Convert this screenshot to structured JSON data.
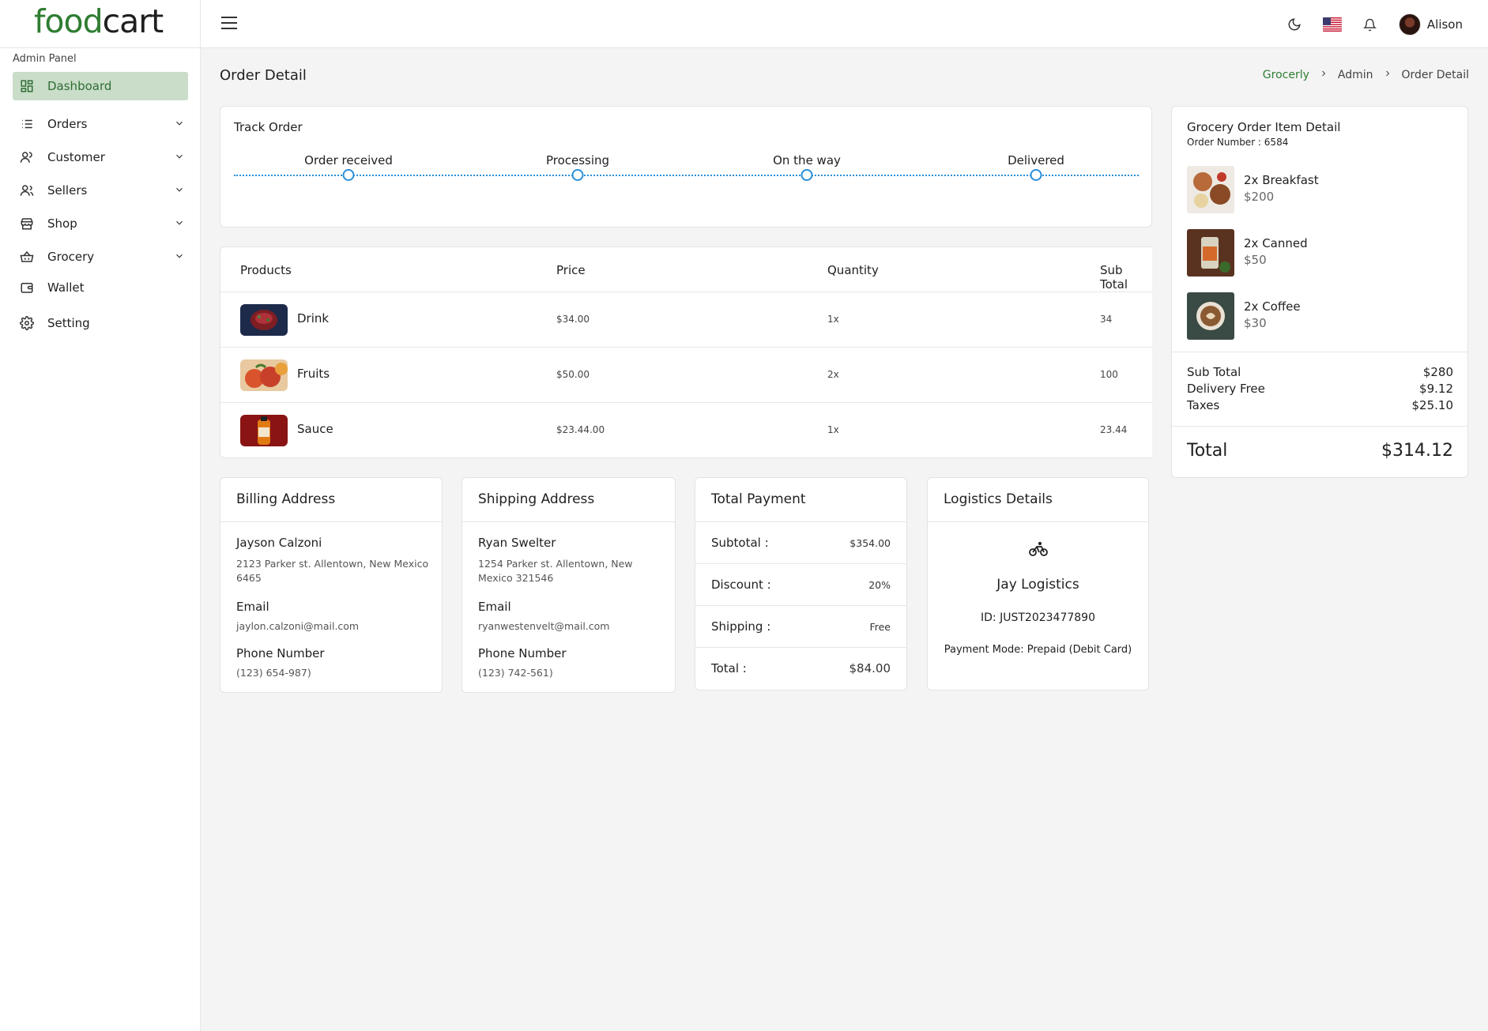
{
  "brand": {
    "part1": "food",
    "part2": "cart"
  },
  "header": {
    "username": "Alison"
  },
  "sidebar": {
    "panel_label": "Admin Panel",
    "items": [
      {
        "label": "Dashboard",
        "icon": "grid-icon"
      },
      {
        "label": "Orders",
        "icon": "list-icon"
      },
      {
        "label": "Customer",
        "icon": "user-icon"
      },
      {
        "label": "Sellers",
        "icon": "users-icon"
      },
      {
        "label": "Shop",
        "icon": "store-icon"
      },
      {
        "label": "Grocery",
        "icon": "basket-icon"
      },
      {
        "label": "Wallet",
        "icon": "wallet-icon"
      },
      {
        "label": "Setting",
        "icon": "gear-icon"
      }
    ]
  },
  "page": {
    "title": "Order Detail",
    "breadcrumb": [
      "Grocerly",
      "Admin",
      "Order Detail"
    ]
  },
  "track": {
    "title": "Track Order",
    "steps": [
      "Order received",
      "Processing",
      "On the way",
      "Delivered"
    ]
  },
  "products": {
    "headers": [
      "Products",
      "Price",
      "Quantity",
      "Sub Total"
    ],
    "rows": [
      {
        "name": "Drink",
        "price": "$34.00",
        "qty": "1x",
        "subtotal": "34"
      },
      {
        "name": "Fruits",
        "price": "$50.00",
        "qty": "2x",
        "subtotal": "100"
      },
      {
        "name": "Sauce",
        "price": "$23.44.00",
        "qty": "1x",
        "subtotal": "23.44"
      }
    ]
  },
  "summary": {
    "title": "Grocery Order Item Detail",
    "order_number": "Order Number : 6584",
    "items": [
      {
        "name": "2x Breakfast",
        "price": "$200"
      },
      {
        "name": "2x Canned",
        "price": "$50"
      },
      {
        "name": "2x Coffee",
        "price": "$30"
      }
    ],
    "lines": [
      {
        "label": "Sub Total",
        "value": "$280"
      },
      {
        "label": "Delivery Free",
        "value": "$9.12"
      },
      {
        "label": "Taxes",
        "value": "$25.10"
      }
    ],
    "total_label": "Total",
    "total_value": "$314.12"
  },
  "billing": {
    "title": "Billing Address",
    "name": "Jayson Calzoni",
    "address": "2123 Parker st. Allentown, New Mexico 6465",
    "email_label": "Email",
    "email": "jaylon.calzoni@mail.com",
    "phone_label": "Phone Number",
    "phone": "(123) 654-987)"
  },
  "shipping": {
    "title": "Shipping Address",
    "name": "Ryan Swelter",
    "address": "1254 Parker st. Allentown, New Mexico 321546",
    "email_label": "Email",
    "email": "ryanwestenvelt@mail.com",
    "phone_label": "Phone Number",
    "phone": "(123) 742-561)"
  },
  "payment": {
    "title": "Total Payment",
    "rows": [
      {
        "label": "Subtotal :",
        "value": "$354.00"
      },
      {
        "label": "Discount :",
        "value": "20%"
      },
      {
        "label": "Shipping :",
        "value": "Free"
      },
      {
        "label": "Total :",
        "value": "$84.00"
      }
    ]
  },
  "logistics": {
    "title": "Logistics Details",
    "company": "Jay Logistics",
    "id": "ID: JUST2023477890",
    "mode": "Payment Mode: Prepaid (Debit Card)"
  },
  "colors": {
    "brand_green": "#2f7d32",
    "active_bg": "#c9ddc9",
    "track_blue": "#2a8fd8"
  }
}
